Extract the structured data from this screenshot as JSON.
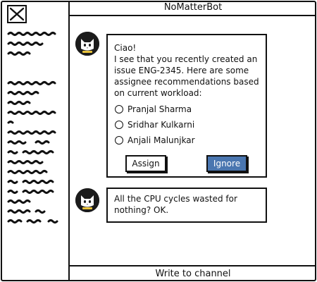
{
  "window": {
    "close_icon": "close-x-icon"
  },
  "header": {
    "title": "NoMatterBot"
  },
  "sidebar": {
    "placeholder_icon": "scribble-text-icon"
  },
  "messages": [
    {
      "avatar_icon": "cat-avatar-icon",
      "greeting": "Ciao!",
      "body": "I see that you recently created an issue ENG-2345. Here are some assignee recommendations based on current workload:",
      "options": [
        "Pranjal Sharma",
        "Sridhar Kulkarni",
        "Anjali Malunjkar"
      ],
      "assign_label": "Assign",
      "ignore_label": "Ignore"
    },
    {
      "avatar_icon": "cat-avatar-icon",
      "body": "All the CPU cycles wasted for nothing? OK."
    }
  ],
  "footer": {
    "input_label": "Write to channel"
  },
  "colors": {
    "ignore_button": "#4a76b0",
    "avatar": "#1b1b1b",
    "avatar_badge": "#e8c23a"
  }
}
